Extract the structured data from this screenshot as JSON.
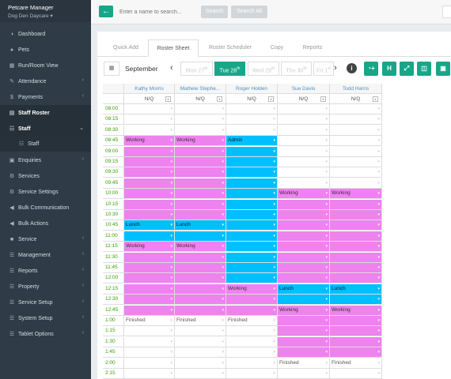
{
  "brand": {
    "title": "Petcare Manager",
    "subtitle": "Dog Den Daycare ▾"
  },
  "nav": [
    {
      "label": "Dashboard",
      "icon": "dashboard-icon",
      "glyph": "◑",
      "arrow": false,
      "state": ""
    },
    {
      "label": "Pets",
      "icon": "paw-icon",
      "glyph": "●",
      "arrow": false,
      "state": ""
    },
    {
      "label": "Run/Room View",
      "icon": "grid-icon",
      "glyph": "▦",
      "arrow": false,
      "state": ""
    },
    {
      "label": "Attendance",
      "icon": "edit-icon",
      "glyph": "✎",
      "arrow": true,
      "state": ""
    },
    {
      "label": "Payments",
      "icon": "dollar-icon",
      "glyph": "$",
      "arrow": true,
      "state": ""
    },
    {
      "label": "Staff Roster",
      "icon": "calendar-icon",
      "glyph": "▤",
      "arrow": false,
      "state": "active"
    },
    {
      "label": "Staff",
      "icon": "sitemap-icon",
      "glyph": "☷",
      "arrow": true,
      "state": "active"
    },
    {
      "label": "Staff",
      "icon": "sitemap-icon",
      "glyph": "☷",
      "arrow": false,
      "state": "sub"
    },
    {
      "label": "Enquiries",
      "icon": "inbox-icon",
      "glyph": "▣",
      "arrow": true,
      "state": ""
    },
    {
      "label": "Services",
      "icon": "gear-icon",
      "glyph": "⚙",
      "arrow": false,
      "state": ""
    },
    {
      "label": "Service Settings",
      "icon": "gear-icon",
      "glyph": "⚙",
      "arrow": false,
      "state": ""
    },
    {
      "label": "Bulk Communication",
      "icon": "bullhorn-icon",
      "glyph": "◀",
      "arrow": false,
      "state": ""
    },
    {
      "label": "Bulk Actions",
      "icon": "bullhorn-icon",
      "glyph": "◀",
      "arrow": false,
      "state": ""
    },
    {
      "label": "Service",
      "icon": "briefcase-icon",
      "glyph": "■",
      "arrow": true,
      "state": ""
    },
    {
      "label": "Management",
      "icon": "list-icon",
      "glyph": "☰",
      "arrow": true,
      "state": ""
    },
    {
      "label": "Reports",
      "icon": "list-icon",
      "glyph": "☰",
      "arrow": true,
      "state": ""
    },
    {
      "label": "Property",
      "icon": "list-icon",
      "glyph": "☰",
      "arrow": true,
      "state": ""
    },
    {
      "label": "Service Setup",
      "icon": "list-icon",
      "glyph": "☰",
      "arrow": true,
      "state": ""
    },
    {
      "label": "System Setup",
      "icon": "list-icon",
      "glyph": "☰",
      "arrow": true,
      "state": ""
    },
    {
      "label": "Tablet Options",
      "icon": "list-icon",
      "glyph": "☰",
      "arrow": true,
      "state": ""
    }
  ],
  "topbar": {
    "back_glyph": "←",
    "name_placeholder": "Enter a name to search...",
    "search_label": "Search",
    "search_all_label": "Search All"
  },
  "tabs": [
    "Quick Add",
    "Roster Sheet",
    "Roster Scheduler",
    "Copy",
    "Reports"
  ],
  "active_tab": 1,
  "controls": {
    "calendar_glyph": "▦",
    "month": "September",
    "prev_glyph": "‹",
    "next_glyph": "›",
    "days": [
      {
        "label": "Mon 27",
        "sup": "th",
        "current": false
      },
      {
        "label": "Tue 28",
        "sup": "th",
        "current": true
      },
      {
        "label": "Wed 29",
        "sup": "th",
        "current": false
      },
      {
        "label": "Thu 30",
        "sup": "th",
        "current": false
      },
      {
        "label": "Fri 1",
        "sup": "st",
        "current": false
      }
    ],
    "info_glyph": "i",
    "tool_buttons": [
      {
        "name": "add-staff-icon",
        "glyph": "◔+"
      },
      {
        "name": "h-icon",
        "glyph": "H"
      },
      {
        "name": "expand-icon",
        "glyph": "⤢"
      },
      {
        "name": "columns-icon",
        "glyph": "◫"
      },
      {
        "name": "lock-icon",
        "glyph": "▣"
      }
    ]
  },
  "roster": {
    "qualification": "N/Q",
    "staff": [
      "Kathy Morris",
      "Mathew Stephe...",
      "Roger Holden",
      "Sue Davis",
      "Todd Harris"
    ],
    "times": [
      "08:00",
      "08:15",
      "08:30",
      "08:45",
      "09:00",
      "09:15",
      "09:30",
      "09:45",
      "10:00",
      "10:15",
      "10:30",
      "10:45",
      "11:00",
      "11:15",
      "11:30",
      "11:45",
      "12:00",
      "12:15",
      "12:30",
      "12:45",
      "1:00",
      "1:15",
      "1:30",
      "1:45",
      "2:00",
      "2:15"
    ],
    "shifts": [
      {
        "col": 0,
        "start": 3,
        "end": 10,
        "color": "pink",
        "label": "Working"
      },
      {
        "col": 0,
        "start": 11,
        "end": 12,
        "color": "blue",
        "label": "Lunch"
      },
      {
        "col": 0,
        "start": 13,
        "end": 19,
        "color": "pink",
        "label": "Working"
      },
      {
        "col": 0,
        "start": 20,
        "end": 20,
        "color": "white",
        "label": "Finished"
      },
      {
        "col": 1,
        "start": 3,
        "end": 10,
        "color": "pink",
        "label": "Working"
      },
      {
        "col": 1,
        "start": 11,
        "end": 12,
        "color": "blue",
        "label": "Lunch"
      },
      {
        "col": 1,
        "start": 13,
        "end": 19,
        "color": "pink",
        "label": "Working"
      },
      {
        "col": 1,
        "start": 20,
        "end": 20,
        "color": "white",
        "label": "Finished"
      },
      {
        "col": 2,
        "start": 3,
        "end": 16,
        "color": "blue",
        "label": "Admin"
      },
      {
        "col": 2,
        "start": 17,
        "end": 19,
        "color": "pink",
        "label": "Working"
      },
      {
        "col": 2,
        "start": 20,
        "end": 20,
        "color": "white",
        "label": "Finished"
      },
      {
        "col": 3,
        "start": 8,
        "end": 16,
        "color": "pink",
        "label": "Working"
      },
      {
        "col": 3,
        "start": 17,
        "end": 18,
        "color": "blue",
        "label": "Lunch"
      },
      {
        "col": 3,
        "start": 19,
        "end": 23,
        "color": "pink",
        "label": "Working"
      },
      {
        "col": 3,
        "start": 24,
        "end": 24,
        "color": "white",
        "label": "Finished"
      },
      {
        "col": 4,
        "start": 8,
        "end": 16,
        "color": "pink",
        "label": "Working"
      },
      {
        "col": 4,
        "start": 17,
        "end": 18,
        "color": "blue",
        "label": "Lunch"
      },
      {
        "col": 4,
        "start": 19,
        "end": 23,
        "color": "pink",
        "label": "Working"
      },
      {
        "col": 4,
        "start": 24,
        "end": 24,
        "color": "white",
        "label": "Finished"
      }
    ],
    "colors": {
      "pink": "#ee82ee",
      "blue": "#00bfff",
      "accent": "#18a689"
    }
  }
}
